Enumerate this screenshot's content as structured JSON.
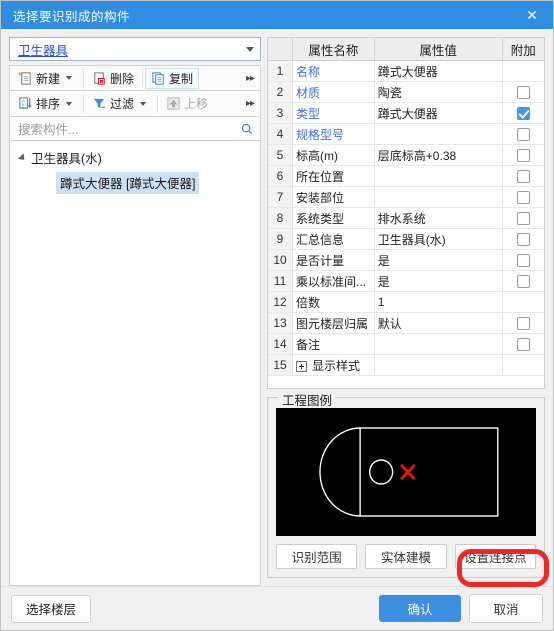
{
  "window": {
    "title": "选择要识别成的构件",
    "close_label": "✕",
    "accent_color": "#2f8de4",
    "title_bar_color": "#2f8de4"
  },
  "left_panel": {
    "category_dropdown": {
      "value": "卫生器具"
    },
    "toolbar_row1": [
      {
        "label": "新建",
        "icon": "new-document-icon",
        "has_dropdown": true,
        "disabled": false
      },
      {
        "label": "删除",
        "icon": "delete-document-icon",
        "has_dropdown": false,
        "disabled": false
      },
      {
        "label": "复制",
        "icon": "copy-document-icon",
        "has_dropdown": false,
        "disabled": false
      }
    ],
    "toolbar_row2": [
      {
        "label": "排序",
        "icon": "sort-az-icon",
        "has_dropdown": true,
        "disabled": false
      },
      {
        "label": "过滤",
        "icon": "filter-funnel-icon",
        "has_dropdown": true,
        "disabled": false
      },
      {
        "label": "上移",
        "icon": "move-up-icon",
        "has_dropdown": false,
        "disabled": true
      }
    ],
    "overflow_label": "▸▸",
    "search": {
      "placeholder": "搜索构件...",
      "value": "",
      "icon": "search-icon"
    },
    "tree": {
      "root_label": "卫生器具(水)",
      "selected_item": "蹲式大便器 [蹲式大便器]"
    }
  },
  "property_grid": {
    "headers": {
      "index": "",
      "name": "属性名称",
      "value": "属性值",
      "attach": "附加"
    },
    "rows": [
      {
        "index": "1",
        "name": "名称",
        "name_blue": true,
        "value": "蹲式大便器",
        "checkbox": "none",
        "expander": false
      },
      {
        "index": "2",
        "name": "材质",
        "name_blue": true,
        "value": "陶瓷",
        "checkbox": "unchecked",
        "expander": false
      },
      {
        "index": "3",
        "name": "类型",
        "name_blue": true,
        "value": "蹲式大便器",
        "checkbox": "checked",
        "expander": false
      },
      {
        "index": "4",
        "name": "规格型号",
        "name_blue": true,
        "value": "",
        "checkbox": "unchecked",
        "expander": false
      },
      {
        "index": "5",
        "name": "标高(m)",
        "name_blue": false,
        "value": "层底标高+0.38",
        "checkbox": "unchecked",
        "expander": false
      },
      {
        "index": "6",
        "name": "所在位置",
        "name_blue": false,
        "value": "",
        "checkbox": "unchecked",
        "expander": false
      },
      {
        "index": "7",
        "name": "安装部位",
        "name_blue": false,
        "value": "",
        "checkbox": "unchecked",
        "expander": false
      },
      {
        "index": "8",
        "name": "系统类型",
        "name_blue": false,
        "value": "排水系统",
        "checkbox": "unchecked",
        "expander": false
      },
      {
        "index": "9",
        "name": "汇总信息",
        "name_blue": false,
        "value": "卫生器具(水)",
        "checkbox": "unchecked",
        "expander": false
      },
      {
        "index": "10",
        "name": "是否计量",
        "name_blue": false,
        "value": "是",
        "checkbox": "unchecked",
        "expander": false
      },
      {
        "index": "11",
        "name": "乘以标准间...",
        "name_blue": false,
        "value": "是",
        "checkbox": "unchecked",
        "expander": false
      },
      {
        "index": "12",
        "name": "倍数",
        "name_blue": false,
        "value": "1",
        "checkbox": "none",
        "expander": false
      },
      {
        "index": "13",
        "name": "图元楼层归属",
        "name_blue": false,
        "value": "默认",
        "checkbox": "unchecked",
        "expander": false
      },
      {
        "index": "14",
        "name": "备注",
        "name_blue": false,
        "value": "",
        "checkbox": "unchecked",
        "expander": false
      },
      {
        "index": "15",
        "name": "显示样式",
        "name_blue": false,
        "value": "",
        "checkbox": "none",
        "expander": true
      }
    ]
  },
  "legend": {
    "group_title": "工程图例",
    "background_color": "#000000",
    "line_color": "#ffffff",
    "marker_color": "#ff0000",
    "marker_icon": "cross-marker-icon"
  },
  "legend_buttons": [
    {
      "label": "识别范围"
    },
    {
      "label": "实体建模"
    },
    {
      "label": "设置连接点",
      "highlighted": true
    }
  ],
  "annotation": {
    "shape": "red-rounded-rectangle",
    "color": "#f5251f",
    "targets": "设置连接点"
  },
  "footer": {
    "select_floor_label": "选择楼层",
    "confirm_label": "确认",
    "cancel_label": "取消",
    "confirm_color": "#3d8fe0"
  }
}
